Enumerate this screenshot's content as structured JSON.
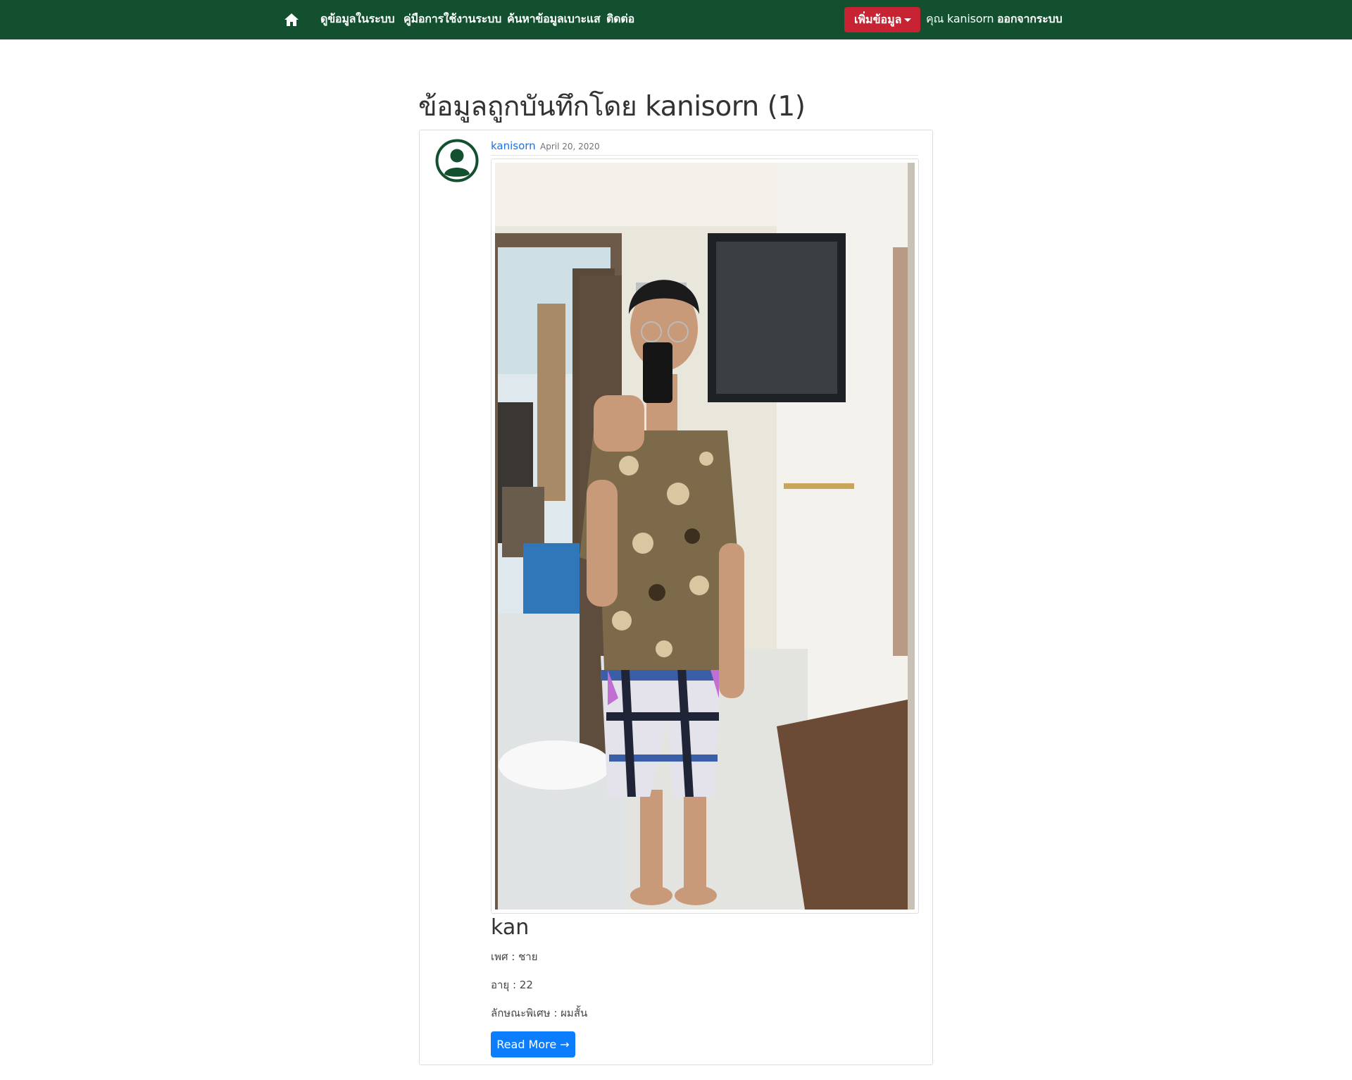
{
  "navbar": {
    "home_icon": "home-icon",
    "links": [
      "ดูข้อมูลในระบบ",
      "คู่มือการใช้งานระบบ",
      "ค้นหาข้อมูลเบาะแส",
      "ติดต่อ"
    ],
    "add_button_label": "เพิ่มข้อมูล",
    "user_label": "คุณ kanisorn",
    "logout_label": "ออกจากระบบ",
    "colors": {
      "background": "#12502f",
      "add_button": "#c82333"
    }
  },
  "main": {
    "title": "ข้อมูลถูกบันทึกโดย kanisorn (1)"
  },
  "post": {
    "avatar_icon": "user-circle-icon",
    "author": "kanisorn",
    "date": "April 20, 2020",
    "photo": "mirror-selfie-photo",
    "name": "kan",
    "gender": "เพศ : ชาย",
    "age": "อายุ : 22",
    "feature": "ลักษณะพิเศษ : ผมสั้น",
    "read_more_label": "Read More →",
    "colors": {
      "link": "#1a73e8",
      "button": "#0b7dfd",
      "avatar": "#12502f"
    }
  }
}
